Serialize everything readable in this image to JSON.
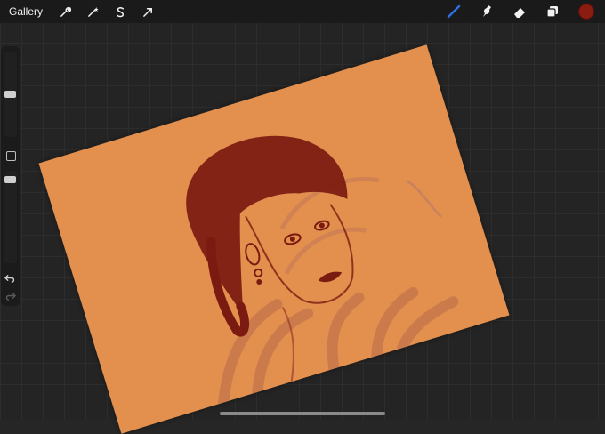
{
  "toolbar": {
    "gallery_label": "Gallery",
    "left_icons": [
      "wrench-icon",
      "magic-wand-icon",
      "selection-icon",
      "transform-arrow-icon"
    ],
    "right_icons": [
      "brush-icon",
      "smudge-icon",
      "eraser-icon",
      "layers-icon"
    ],
    "brush_color": "#2f6fe0",
    "current_color": "#8b1c12"
  },
  "sidebar": {
    "brush_size_level": 0.35,
    "opacity_level": 0.0,
    "icons": [
      "modify-square-icon",
      "undo-icon",
      "redo-icon"
    ]
  },
  "artwork": {
    "paper_color": "#e38f4e",
    "ink_color": "#7a1a10"
  }
}
